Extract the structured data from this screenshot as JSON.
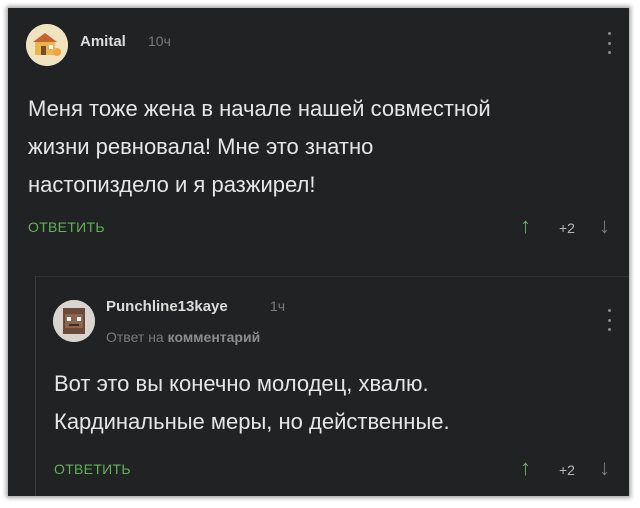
{
  "comments": [
    {
      "username": "Amital",
      "time": "10ч",
      "text": "Меня тоже жена в начале нашей совместной\nжизни ревновала! Мне это знатно\nнастопиздело и я разжирел!",
      "reply_label": "ОТВЕТИТЬ",
      "rating": "+2",
      "avatar_icon": "cartoon-house-avatar"
    },
    {
      "username": "Punchline13kaye",
      "time": "1ч",
      "reply_to_prefix": "Ответ на",
      "reply_to_target": "комментарий",
      "text": "Вот это вы конечно молодец, хвалю.\nКардинальные меры, но действенные.",
      "reply_label": "ОТВЕТИТЬ",
      "rating": "+2",
      "avatar_icon": "pixel-character-avatar"
    }
  ],
  "icons": {
    "upvote": "↑",
    "downvote": "↓"
  },
  "colors": {
    "background": "#212223",
    "accent_green": "#5fb357",
    "text": "#e6e6e6",
    "muted": "#7b7b7b"
  }
}
